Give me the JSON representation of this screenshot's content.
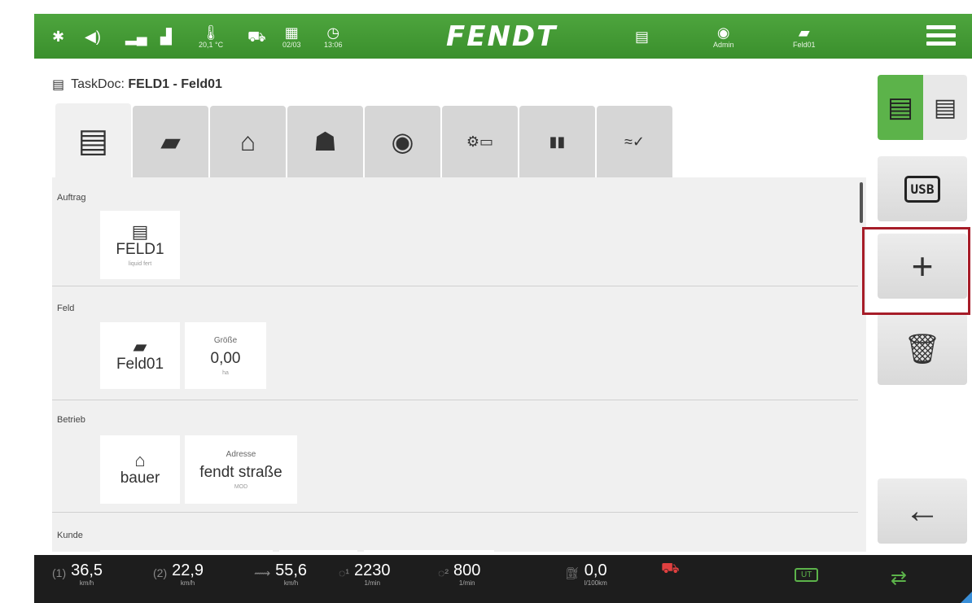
{
  "topbar": {
    "temperature": "20,1 °C",
    "date": "02/03",
    "time": "13:06",
    "brand": "FENDT",
    "user": "Admin",
    "field": "Feld01"
  },
  "header": {
    "doc_prefix": "TaskDoc: ",
    "doc_name": "FELD1 - Feld01"
  },
  "sections": {
    "auftrag": {
      "label": "Auftrag",
      "card_value": "FELD1",
      "card_sub": "liquid fert"
    },
    "feld": {
      "label": "Feld",
      "name_value": "Feld01",
      "size_caption": "Größe",
      "size_value": "0,00",
      "size_unit": "ha"
    },
    "betrieb": {
      "label": "Betrieb",
      "name_value": "bauer",
      "address_caption": "Adresse",
      "address_value": "fendt straße",
      "address_sub": "MOD"
    },
    "kunde": {
      "label": "Kunde"
    }
  },
  "statusbar": {
    "speed1": {
      "value": "36,5",
      "unit": "km/h"
    },
    "speed2": {
      "value": "22,9",
      "unit": "km/h"
    },
    "speed3": {
      "value": "55,6",
      "unit": "km/h"
    },
    "rpm1": {
      "value": "2230",
      "unit": "1/min"
    },
    "rpm2": {
      "value": "800",
      "unit": "1/min"
    },
    "fuel": {
      "value": "0,0",
      "unit": "l/100km"
    },
    "ut_label": "UT"
  },
  "colors": {
    "topbar_green": "#3a8f2c",
    "active_green": "#5cb34a",
    "highlight_red": "#a61c28"
  }
}
